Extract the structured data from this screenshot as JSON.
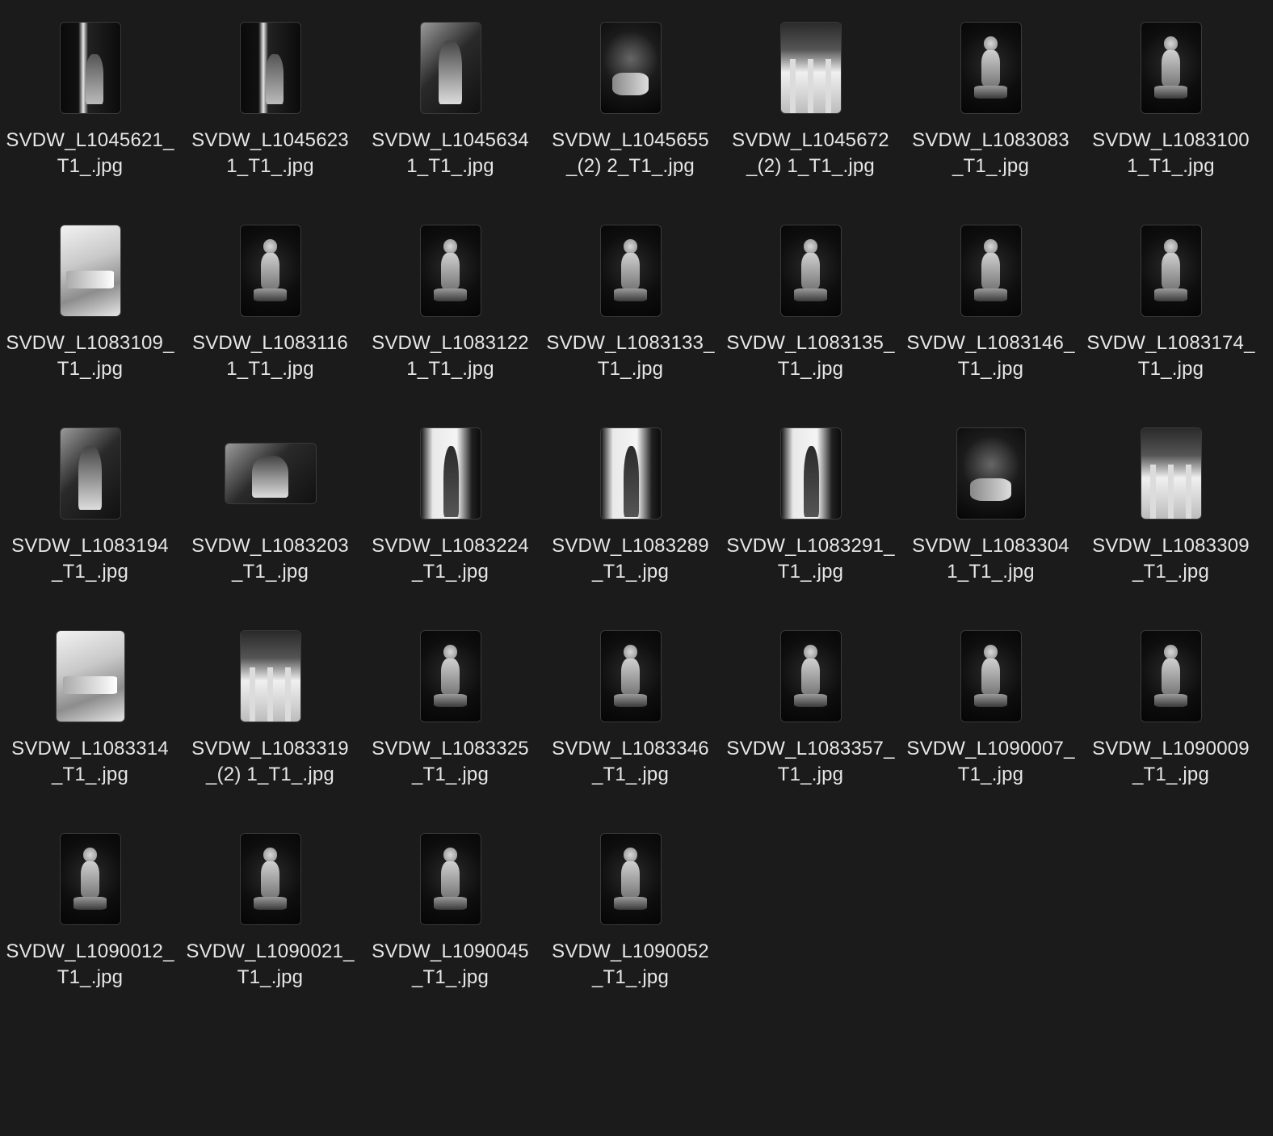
{
  "files": [
    {
      "line1": "SVDW_L1045621_",
      "line2": "T1_.jpg",
      "thumb": "portrait",
      "tone": "dark-left-light"
    },
    {
      "line1": "SVDW_L1045623",
      "line2": "1_T1_.jpg",
      "thumb": "portrait",
      "tone": "dark-left-light"
    },
    {
      "line1": "SVDW_L1045634",
      "line2": "1_T1_.jpg",
      "thumb": "portrait",
      "tone": "mid"
    },
    {
      "line1": "SVDW_L1045655",
      "line2": "_(2) 2_T1_.jpg",
      "thumb": "portrait",
      "tone": "dark"
    },
    {
      "line1": "SVDW_L1045672",
      "line2": "_(2) 1_T1_.jpg",
      "thumb": "portrait",
      "tone": "light-bottom"
    },
    {
      "line1": "SVDW_L1083083",
      "line2": "_T1_.jpg",
      "thumb": "portrait",
      "tone": "figure"
    },
    {
      "line1": "SVDW_L1083100",
      "line2": "1_T1_.jpg",
      "thumb": "portrait",
      "tone": "figure"
    },
    {
      "line1": "SVDW_L1083109_",
      "line2": "T1_.jpg",
      "thumb": "portrait",
      "tone": "light"
    },
    {
      "line1": "SVDW_L1083116",
      "line2": "1_T1_.jpg",
      "thumb": "portrait",
      "tone": "figure"
    },
    {
      "line1": "SVDW_L1083122",
      "line2": "1_T1_.jpg",
      "thumb": "portrait",
      "tone": "figure"
    },
    {
      "line1": "SVDW_L1083133_",
      "line2": "T1_.jpg",
      "thumb": "portrait",
      "tone": "figure"
    },
    {
      "line1": "SVDW_L1083135_",
      "line2": "T1_.jpg",
      "thumb": "portrait",
      "tone": "figure"
    },
    {
      "line1": "SVDW_L1083146_",
      "line2": "T1_.jpg",
      "thumb": "portrait",
      "tone": "figure"
    },
    {
      "line1": "SVDW_L1083174_",
      "line2": "T1_.jpg",
      "thumb": "portrait",
      "tone": "figure"
    },
    {
      "line1": "SVDW_L1083194",
      "line2": "_T1_.jpg",
      "thumb": "portrait",
      "tone": "mid"
    },
    {
      "line1": "SVDW_L1083203",
      "line2": "_T1_.jpg",
      "thumb": "landscape",
      "tone": "mid"
    },
    {
      "line1": "SVDW_L1083224",
      "line2": "_T1_.jpg",
      "thumb": "portrait",
      "tone": "window"
    },
    {
      "line1": "SVDW_L1083289",
      "line2": "_T1_.jpg",
      "thumb": "portrait",
      "tone": "window"
    },
    {
      "line1": "SVDW_L1083291_",
      "line2": "T1_.jpg",
      "thumb": "portrait",
      "tone": "window"
    },
    {
      "line1": "SVDW_L1083304",
      "line2": "1_T1_.jpg",
      "thumb": "wide-portrait",
      "tone": "dark"
    },
    {
      "line1": "SVDW_L1083309",
      "line2": "_T1_.jpg",
      "thumb": "portrait",
      "tone": "light-bottom"
    },
    {
      "line1": "SVDW_L1083314",
      "line2": "_T1_.jpg",
      "thumb": "wide-portrait",
      "tone": "light"
    },
    {
      "line1": "SVDW_L1083319",
      "line2": "_(2) 1_T1_.jpg",
      "thumb": "portrait",
      "tone": "light-bottom"
    },
    {
      "line1": "SVDW_L1083325",
      "line2": "_T1_.jpg",
      "thumb": "portrait",
      "tone": "figure"
    },
    {
      "line1": "SVDW_L1083346",
      "line2": "_T1_.jpg",
      "thumb": "portrait",
      "tone": "figure"
    },
    {
      "line1": "SVDW_L1083357_",
      "line2": "T1_.jpg",
      "thumb": "portrait",
      "tone": "figure"
    },
    {
      "line1": "SVDW_L1090007_",
      "line2": "T1_.jpg",
      "thumb": "portrait",
      "tone": "figure"
    },
    {
      "line1": "SVDW_L1090009",
      "line2": "_T1_.jpg",
      "thumb": "portrait",
      "tone": "figure"
    },
    {
      "line1": "SVDW_L1090012_",
      "line2": "T1_.jpg",
      "thumb": "portrait",
      "tone": "figure"
    },
    {
      "line1": "SVDW_L1090021_",
      "line2": "T1_.jpg",
      "thumb": "portrait",
      "tone": "figure"
    },
    {
      "line1": "SVDW_L1090045",
      "line2": "_T1_.jpg",
      "thumb": "portrait",
      "tone": "figure"
    },
    {
      "line1": "SVDW_L1090052",
      "line2": "_T1_.jpg",
      "thumb": "portrait",
      "tone": "figure"
    }
  ]
}
